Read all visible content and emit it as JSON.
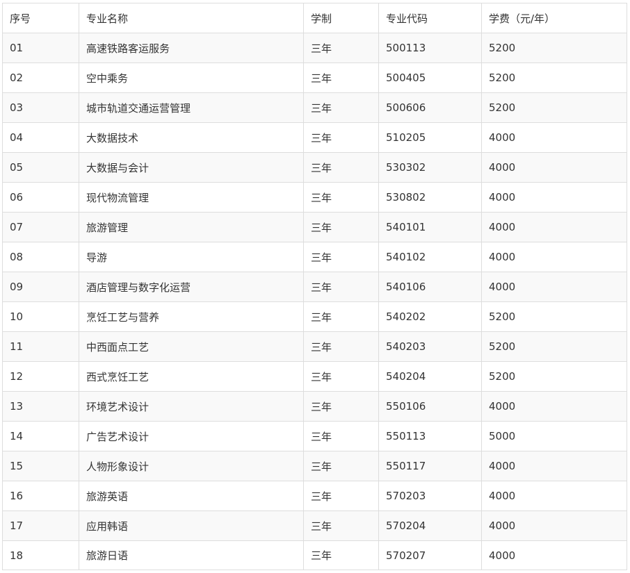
{
  "table": {
    "headers": [
      "序号",
      "专业名称",
      "学制",
      "专业代码",
      "学费（元/年）"
    ],
    "rows": [
      [
        "01",
        "高速铁路客运服务",
        "三年",
        "500113",
        "5200"
      ],
      [
        "02",
        "空中乘务",
        "三年",
        "500405",
        "5200"
      ],
      [
        "03",
        "城市轨道交通运营管理",
        "三年",
        "500606",
        "5200"
      ],
      [
        "04",
        "大数据技术",
        "三年",
        "510205",
        "4000"
      ],
      [
        "05",
        "大数据与会计",
        "三年",
        "530302",
        "4000"
      ],
      [
        "06",
        "现代物流管理",
        "三年",
        "530802",
        "4000"
      ],
      [
        "07",
        "旅游管理",
        "三年",
        "540101",
        "4000"
      ],
      [
        "08",
        "导游",
        "三年",
        "540102",
        "4000"
      ],
      [
        "09",
        "酒店管理与数字化运营",
        "三年",
        "540106",
        "4000"
      ],
      [
        "10",
        "烹饪工艺与营养",
        "三年",
        "540202",
        "5200"
      ],
      [
        "11",
        "中西面点工艺",
        "三年",
        "540203",
        "5200"
      ],
      [
        "12",
        "西式烹饪工艺",
        "三年",
        "540204",
        "5200"
      ],
      [
        "13",
        "环境艺术设计",
        "三年",
        "550106",
        "4000"
      ],
      [
        "14",
        "广告艺术设计",
        "三年",
        "550113",
        "5000"
      ],
      [
        "15",
        "人物形象设计",
        "三年",
        "550117",
        "4000"
      ],
      [
        "16",
        "旅游英语",
        "三年",
        "570203",
        "4000"
      ],
      [
        "17",
        "应用韩语",
        "三年",
        "570204",
        "4000"
      ],
      [
        "18",
        "旅游日语",
        "三年",
        "570207",
        "4000"
      ]
    ]
  }
}
